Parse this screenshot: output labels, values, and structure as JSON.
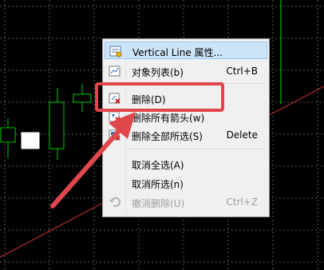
{
  "menu": {
    "items": [
      {
        "label": "Vertical Line 属性...",
        "shortcut": "",
        "icon": "properties-icon"
      },
      {
        "label": "对象列表(b)",
        "shortcut": "Ctrl+B",
        "icon": "object-list-icon"
      },
      {
        "label": "删除(D)",
        "shortcut": "",
        "icon": "delete-icon"
      },
      {
        "label": "删除所有箭头(w)",
        "shortcut": "",
        "icon": "delete-arrows-icon"
      },
      {
        "label": "删除全部所选(S)",
        "shortcut": "Delete",
        "icon": "delete-selected-icon"
      },
      {
        "label": "取消全选(A)",
        "shortcut": "",
        "icon": ""
      },
      {
        "label": "取消所选(n)",
        "shortcut": "",
        "icon": ""
      },
      {
        "label": "撤消删除(U)",
        "shortcut": "Ctrl+Z",
        "icon": "undo-icon"
      }
    ]
  },
  "colors": {
    "background": "#000000",
    "grid": "#5a5a5a",
    "candle_up": "#00cc00",
    "trend_line": "#c83232",
    "vertical_line": "#00dd00",
    "annotation": "#e0474c",
    "menu_highlight": "#cce4f7"
  }
}
